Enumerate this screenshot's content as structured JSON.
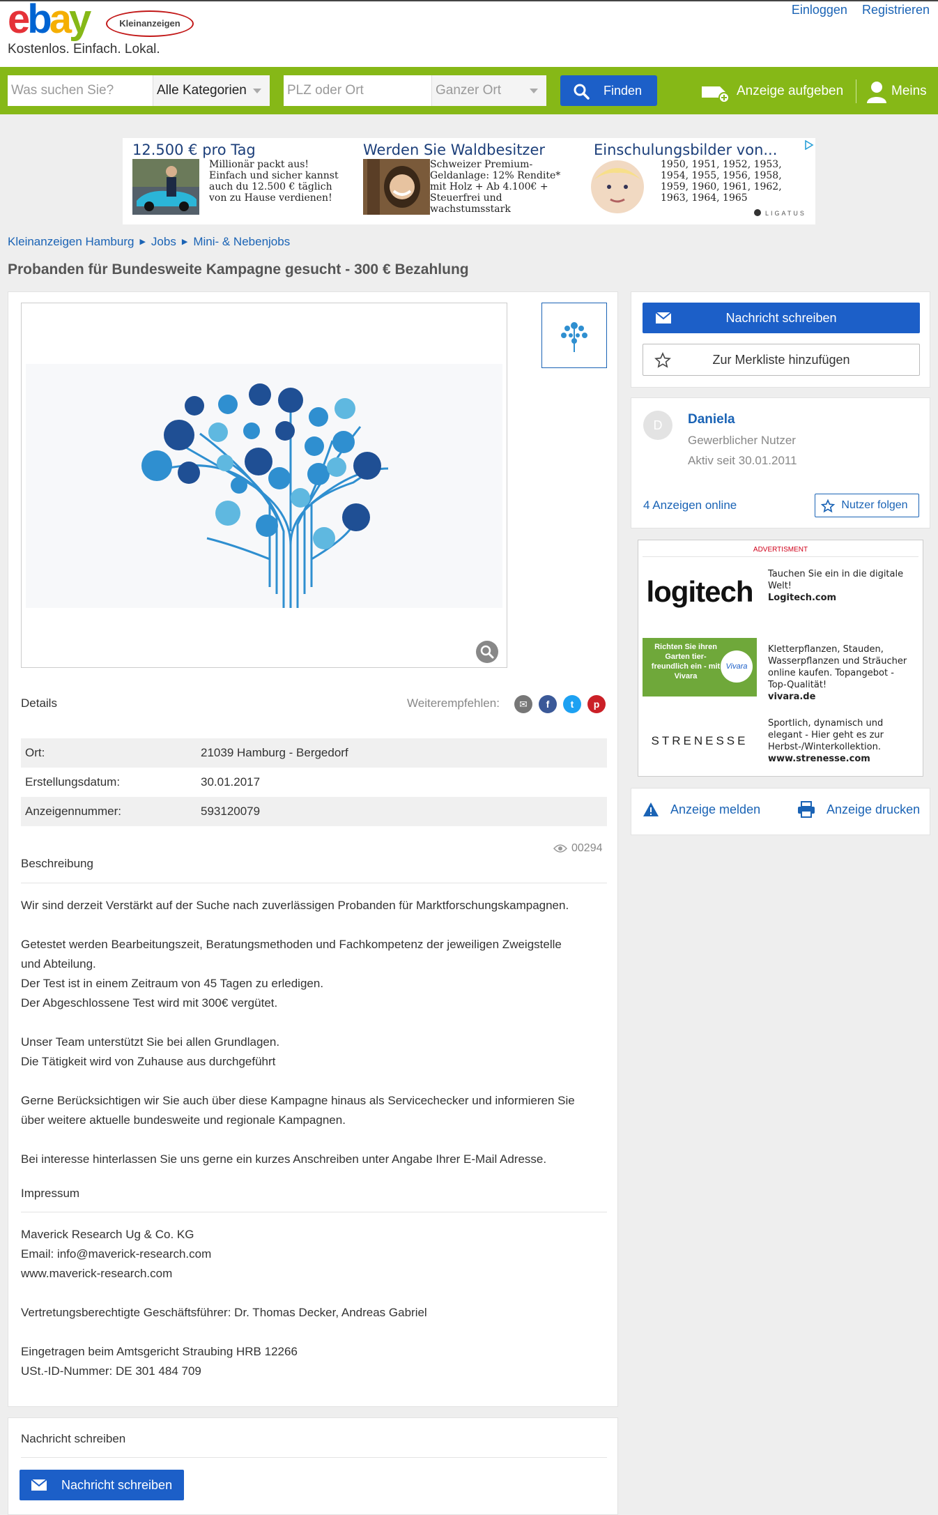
{
  "header": {
    "logo_letters": [
      "e",
      "b",
      "a",
      "y"
    ],
    "logo_badge": "Kleinanzeigen",
    "tagline": "Kostenlos. Einfach. Lokal.",
    "login": "Einloggen",
    "register": "Registrieren",
    "brand_colors": {
      "red": "#e53238",
      "blue": "#0064d2",
      "yellow": "#f5af02",
      "green": "#86b817"
    }
  },
  "search": {
    "query_placeholder": "Was suchen Sie?",
    "category": "Alle Kategorien",
    "location_placeholder": "PLZ oder Ort",
    "radius": "Ganzer Ort",
    "find_label": "Finden",
    "post_ad_label": "Anzeige aufgeben",
    "meins_label": "Meins",
    "bar_color": "#86b817",
    "button_color": "#1c5fc8"
  },
  "banner": {
    "items": [
      {
        "title": "12.500 € pro Tag",
        "text": "Millionär packt aus! Einfach und sicher kannst auch du 12.500 € täglich von zu Hause verdienen!"
      },
      {
        "title": "Werden Sie Waldbesitzer",
        "text": "Schweizer Premium-Geldanlage: 12% Rendite* mit Holz + Ab 4.100€ + Steuerfrei und wachstumsstark"
      },
      {
        "title": "Einschulungsbilder von...",
        "text": "1950, 1951, 1952, 1953, 1954, 1955, 1956, 1958, 1959, 1960, 1961, 1962, 1963, 1964, 1965"
      }
    ],
    "network": "LIGATUS"
  },
  "breadcrumb": [
    "Kleinanzeigen Hamburg",
    "Jobs",
    "Mini- & Nebenjobs"
  ],
  "ad": {
    "title": "Probanden für Bundesweite Kampagne gesucht - 300 € Bezahlung",
    "details_heading": "Details",
    "share_label": "Weiterempfehlen:",
    "share_icons": [
      "email-icon",
      "facebook-icon",
      "twitter-icon",
      "pinterest-icon"
    ],
    "details": [
      {
        "key": "Ort:",
        "value": "21039 Hamburg - Bergedorf"
      },
      {
        "key": "Erstellungsdatum:",
        "value": "30.01.2017"
      },
      {
        "key": "Anzeigennummer:",
        "value": "593120079"
      }
    ],
    "views": "00294",
    "description_heading": "Beschreibung",
    "description": [
      "Wir sind derzeit Verstärkt auf der Suche nach zuverlässigen Probanden für Marktforschungskampagnen.",
      "Getestet werden Bearbeitungszeit, Beratungsmethoden und Fachkompetenz der jeweiligen Zweigstelle",
      "und Abteilung.",
      "Der Test ist in einem Zeitraum von 45 Tagen zu erledigen.",
      "Der Abgeschlossene Test wird mit 300€ vergütet.",
      "Unser Team unterstützt Sie bei allen Grundlagen.",
      "Die Tätigkeit wird von Zuhause aus durchgeführt",
      "Gerne Berücksichtigen wir Sie auch über diese Kampagne hinaus als Servicechecker und informieren Sie",
      "über weitere aktuelle bundesweite und regionale Kampagnen.",
      "Bei interesse hinterlassen Sie uns gerne ein kurzes Anschreiben unter Angabe Ihrer E-Mail Adresse."
    ],
    "impressum_heading": "Impressum",
    "impressum": [
      "Maverick Research Ug & Co. KG",
      "Email: info@maverick-research.com",
      "www.maverick-research.com",
      "Vertretungsberechtigte Geschäftsführer: Dr. Thomas Decker, Andreas Gabriel",
      "Eingetragen beim Amtsgericht Straubing HRB 12266",
      "USt.-ID-Nummer: DE 301 484 709"
    ]
  },
  "actions": {
    "message": "Nachricht schreiben",
    "watchlist": "Zur Merkliste hinzufügen"
  },
  "seller": {
    "initial": "D",
    "name": "Daniela",
    "type": "Gewerblicher Nutzer",
    "active_since": "Aktiv seit 30.01.2011",
    "ads_online": "4 Anzeigen online",
    "follow": "Nutzer folgen"
  },
  "side_ad": {
    "label": "ADVERTISMENT",
    "items": [
      {
        "brand": "logitech",
        "text": "Tauchen Sie ein in die digitale Welt!",
        "url": "Logitech.com"
      },
      {
        "brand": "Vivara",
        "brand_text": "Richten Sie ihren Garten tier-freundlich ein - mit Vivara",
        "text": "Kletterpflanzen, Stauden, Wasserpflanzen und Sträucher online kaufen. Topangebot - Top-Qualität!",
        "url": "vivara.de"
      },
      {
        "brand": "STRENESSE",
        "text": "Sportlich, dynamisch und elegant - Hier geht es zur Herbst-/Winterkollektion.",
        "url": "www.strenesse.com"
      }
    ]
  },
  "report": {
    "report_label": "Anzeige melden",
    "print_label": "Anzeige drucken"
  },
  "bottom": {
    "heading": "Nachricht schreiben",
    "button": "Nachricht schreiben"
  }
}
